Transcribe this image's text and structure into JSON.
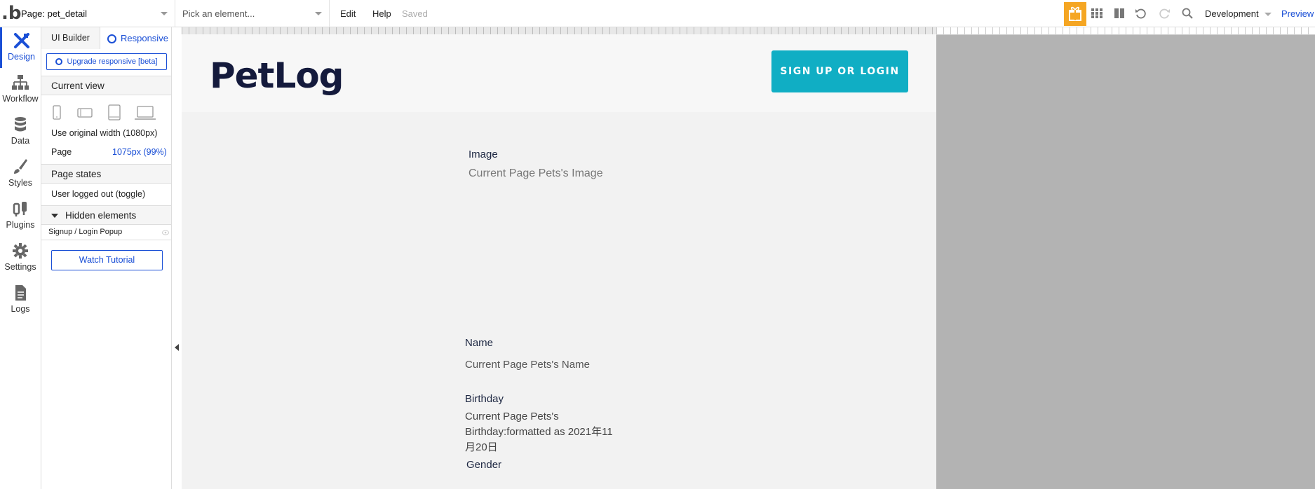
{
  "topbar": {
    "page_selector": "Page: pet_detail",
    "element_picker_placeholder": "Pick an element...",
    "menu_edit": "Edit",
    "menu_help": "Help",
    "status": "Saved",
    "environment": "Development",
    "preview": "Preview",
    "accent_color": "#f5a623"
  },
  "leftnav": {
    "items": [
      {
        "label": "Design",
        "icon": "design-icon"
      },
      {
        "label": "Workflow",
        "icon": "workflow-icon"
      },
      {
        "label": "Data",
        "icon": "database-icon"
      },
      {
        "label": "Styles",
        "icon": "brush-icon"
      },
      {
        "label": "Plugins",
        "icon": "plug-icon"
      },
      {
        "label": "Settings",
        "icon": "gear-icon"
      },
      {
        "label": "Logs",
        "icon": "document-icon"
      }
    ]
  },
  "panel": {
    "tab_ui_builder": "UI Builder",
    "tab_responsive": "Responsive",
    "upgrade_button": "Upgrade responsive [beta]",
    "current_view_title": "Current view",
    "original_width": "Use original width (1080px)",
    "page_label": "Page",
    "page_value": "1075px (99%)",
    "page_states_title": "Page states",
    "page_state_item": "User logged out (toggle)",
    "hidden_elements_title": "Hidden elements",
    "hidden_item": "Signup / Login Popup",
    "watch_tutorial": "Watch Tutorial"
  },
  "canvas": {
    "brand": "PetLog",
    "cta": "SIGN UP OR LOGIN",
    "cta_color": "#10aec4",
    "image_label": "Image",
    "image_value": "Current Page Pets's Image",
    "name_label": "Name",
    "name_value": "Current Page Pets's Name",
    "birthday_label": "Birthday",
    "birthday_value_line1": "Current Page Pets's",
    "birthday_value_line2": "Birthday:formatted as 2021年11",
    "birthday_value_line3": "月20日",
    "gender_label": "Gender"
  }
}
